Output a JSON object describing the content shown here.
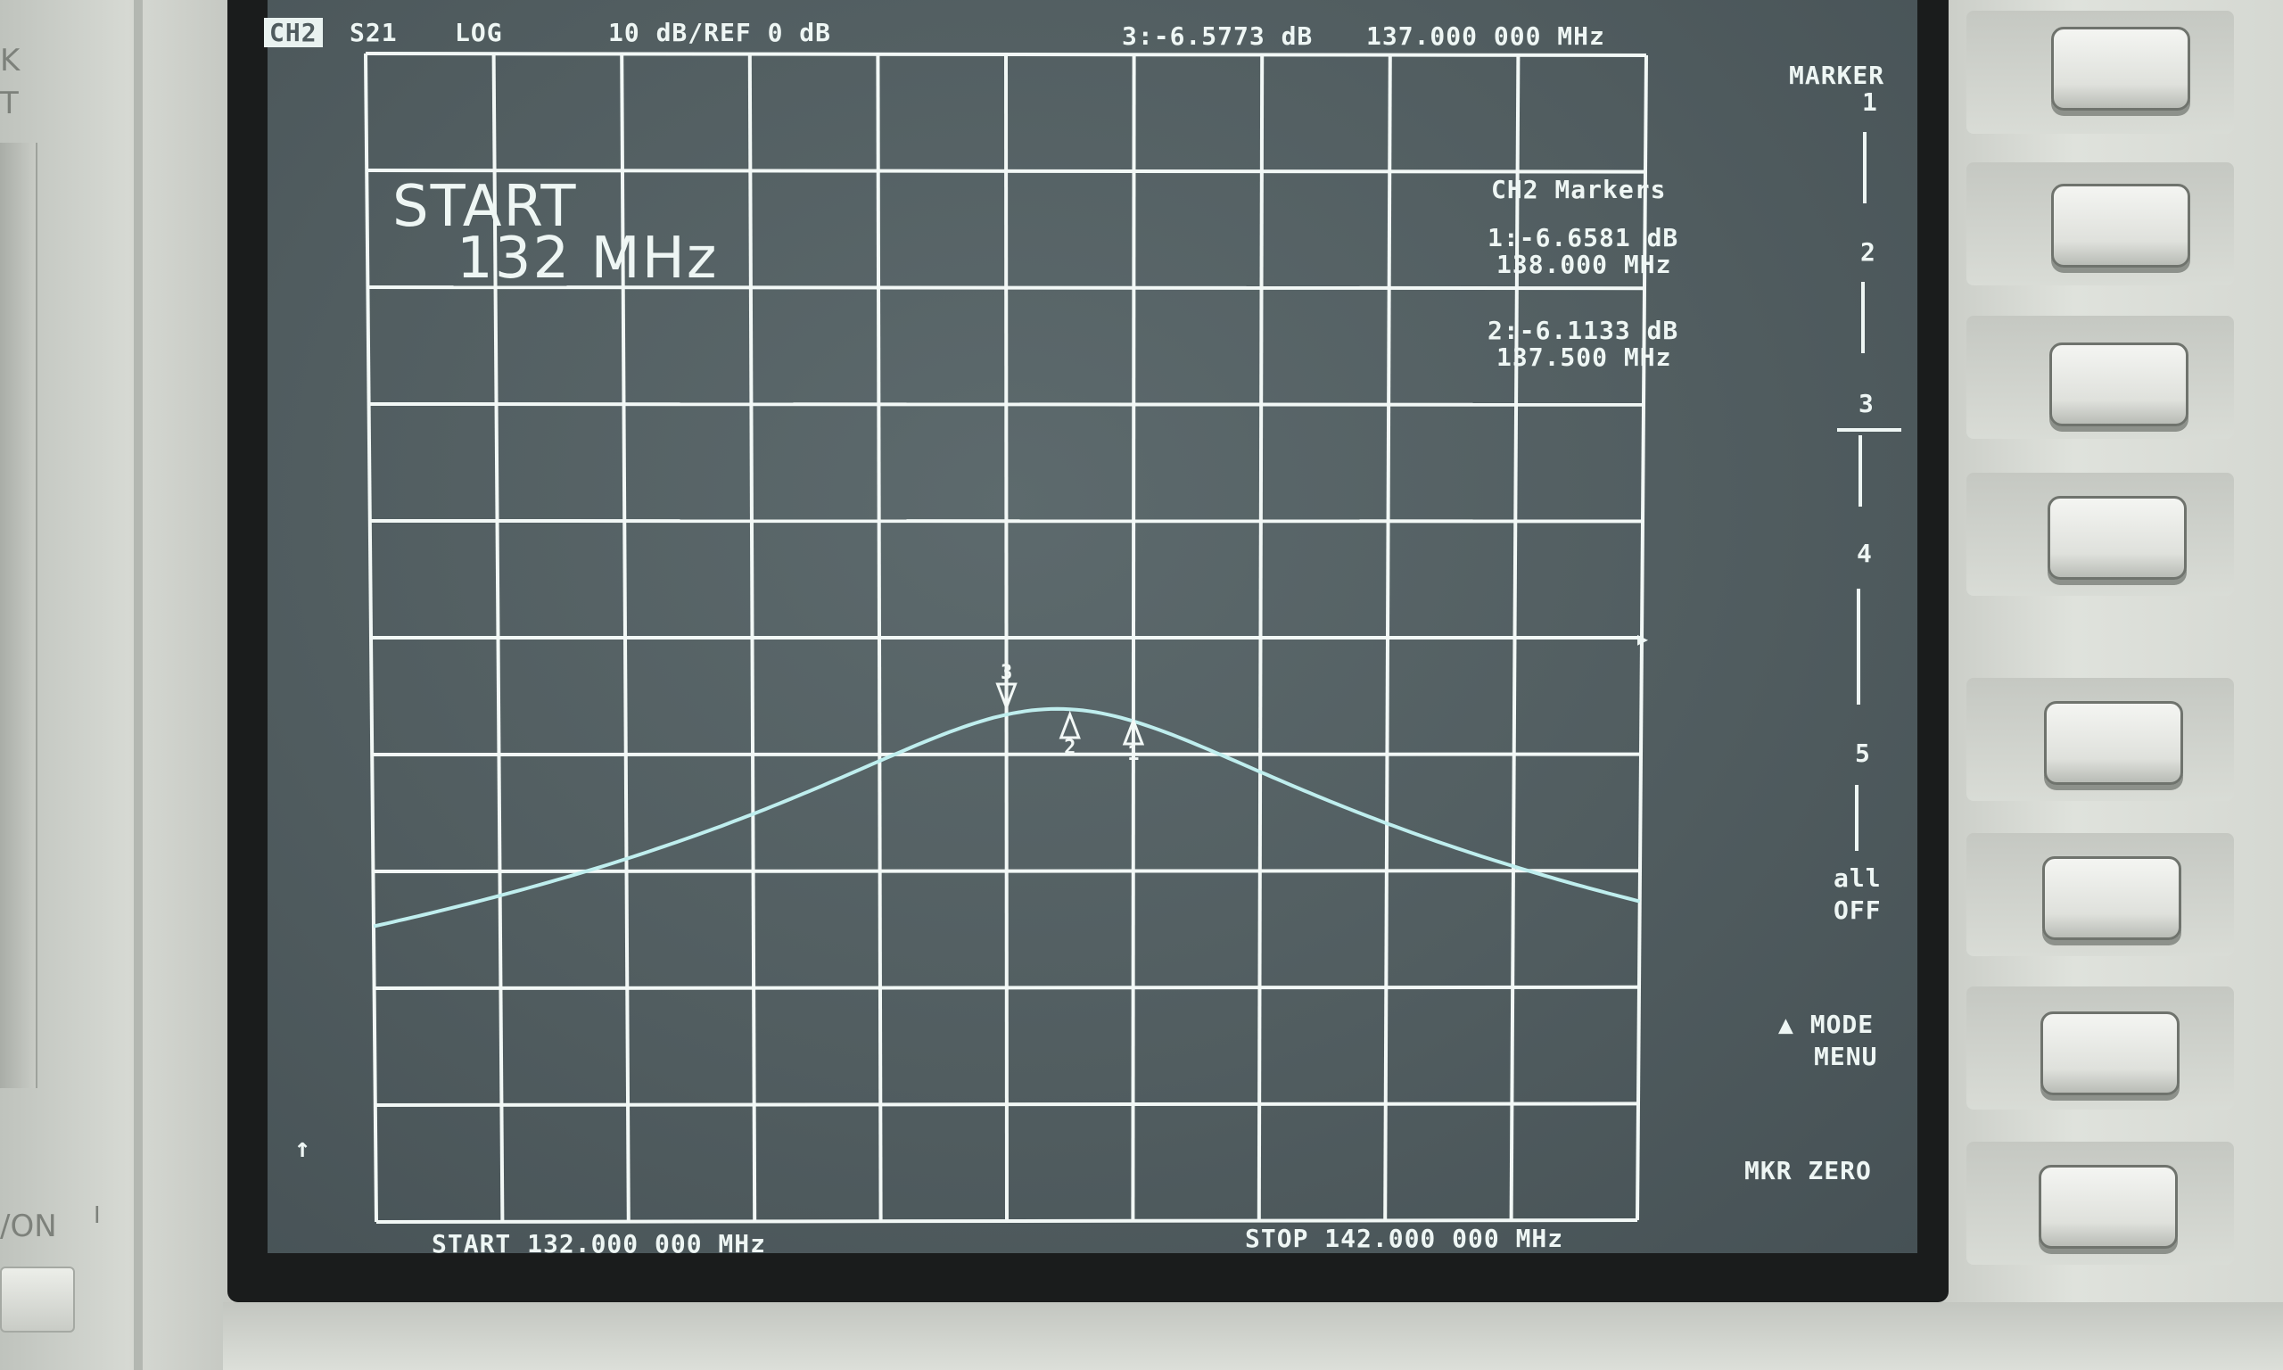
{
  "left_panel": {
    "label_top_1": "K",
    "label_top_2": "T",
    "label_power": "/ON",
    "label_power_mark": "I"
  },
  "header": {
    "channel": "CH2",
    "parameter": "S21",
    "format": "LOG",
    "scale": "10 dB/REF 0 dB",
    "active_marker_readout": "3:-6.5773 dB",
    "active_marker_freq": "137.000 000 MHz"
  },
  "overlay": {
    "start_word": "START",
    "start_value": "132 MHz"
  },
  "marker_table": {
    "title": "CH2 Markers",
    "m1_value": "1:-6.6581 dB",
    "m1_freq": "138.000 MHz",
    "m2_value": "2:-6.1133 dB",
    "m2_freq": "137.500 MHz"
  },
  "footer": {
    "start_label": "START 132.000 000 MHz",
    "stop_label": "STOP 142.000 000 MHz"
  },
  "softkeys": {
    "title_line1": "MARKER",
    "title_line2": "1",
    "k2": "2",
    "k3": "3",
    "k4": "4",
    "k5": "5",
    "all_off_line1": "all",
    "all_off_line2": "OFF",
    "mode_menu_line1": "▲ MODE",
    "mode_menu_line2": "MENU",
    "mkr_zero": "MKR ZERO"
  },
  "markers_on_trace": [
    {
      "label": "3",
      "freq_mhz": 137.0,
      "db": -6.5773
    },
    {
      "label": "2",
      "freq_mhz": 137.5,
      "db": -6.1133
    },
    {
      "label": "1",
      "freq_mhz": 138.0,
      "db": -6.6581
    }
  ],
  "reference_marker_glyph": "▶",
  "scale_up_arrow": "↑",
  "colors": {
    "trace": "#bfeeee",
    "graticule": "#f2f8f6",
    "screen_bg": "#4f5b5e"
  }
}
